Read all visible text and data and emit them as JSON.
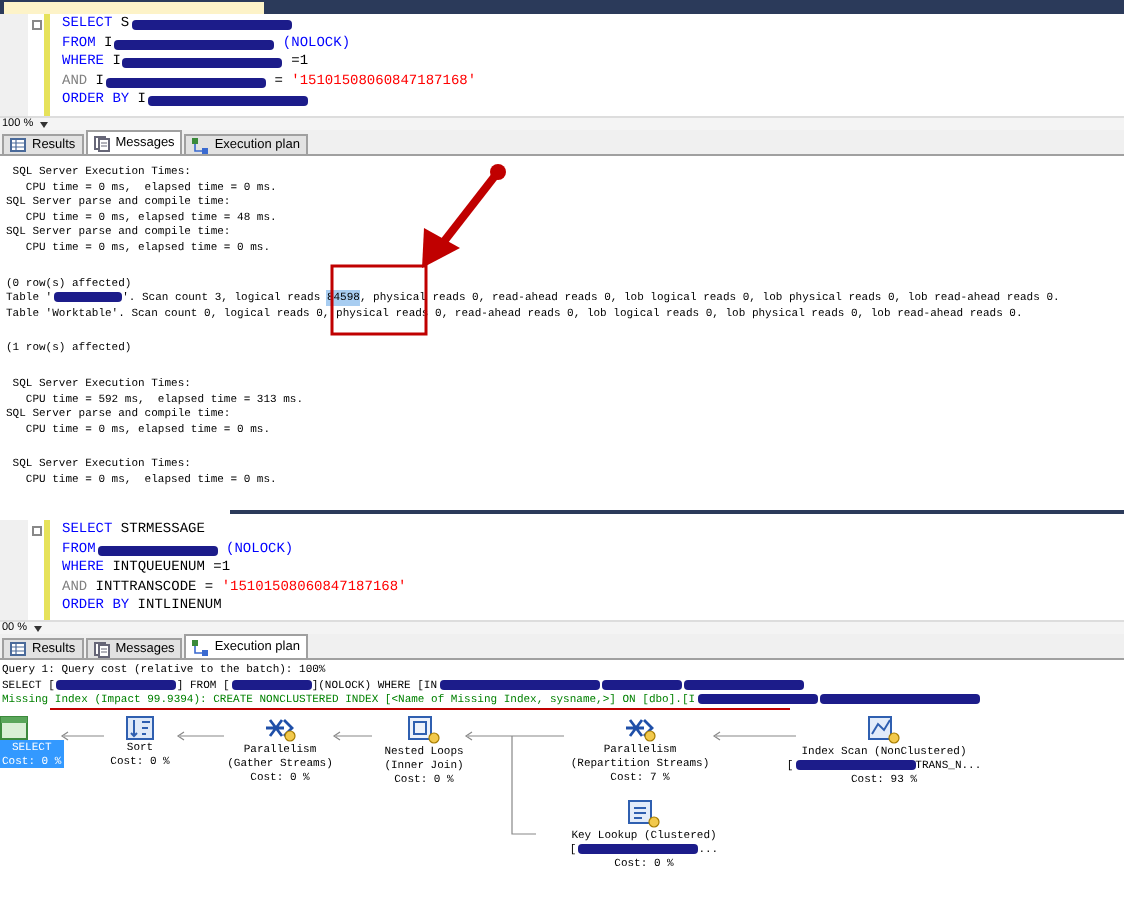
{
  "top_editor": {
    "lines": [
      [
        {
          "kind": "keyword",
          "text": "SELECT"
        },
        {
          "kind": "text",
          "text": " S"
        },
        {
          "kind": "redacted"
        }
      ],
      [
        {
          "kind": "keyword",
          "text": "FROM"
        },
        {
          "kind": "text",
          "text": " I"
        },
        {
          "kind": "redacted"
        },
        {
          "kind": "keyword",
          "text": " (NOLOCK)"
        }
      ],
      [
        {
          "kind": "keyword",
          "text": "WHERE"
        },
        {
          "kind": "text",
          "text": " I"
        },
        {
          "kind": "redacted"
        },
        {
          "kind": "text",
          "text": " =1"
        }
      ],
      [
        {
          "kind": "operator",
          "text": "AND"
        },
        {
          "kind": "text",
          "text": " I"
        },
        {
          "kind": "redacted"
        },
        {
          "kind": "text",
          "text": " = "
        },
        {
          "kind": "string",
          "text": "'15101508060847187168'"
        }
      ],
      [
        {
          "kind": "keyword",
          "text": "ORDER BY"
        },
        {
          "kind": "text",
          "text": " I"
        },
        {
          "kind": "redacted"
        }
      ]
    ],
    "zoom": "100 %"
  },
  "top_tabs": [
    {
      "label": "Results",
      "kind": "grid",
      "selected": false
    },
    {
      "label": "Messages",
      "kind": "messages",
      "selected": true
    },
    {
      "label": "Execution plan",
      "kind": "plan",
      "selected": false
    }
  ],
  "messages": [
    [
      [
        {
          "kind": "text",
          "text": " SQL Server Execution Times:"
        }
      ],
      [
        {
          "kind": "text",
          "text": "   CPU time = 0 ms,  elapsed time = 0 ms."
        }
      ],
      [
        {
          "kind": "text",
          "text": "SQL Server parse and compile time:"
        }
      ],
      [
        {
          "kind": "text",
          "text": "   CPU time = 0 ms, elapsed time = 48 ms."
        }
      ],
      [
        {
          "kind": "text",
          "text": "SQL Server parse and compile time:"
        }
      ],
      [
        {
          "kind": "text",
          "text": "   CPU time = 0 ms, elapsed time = 0 ms."
        }
      ]
    ],
    [
      [
        {
          "kind": "text",
          "text": "(0 row(s) affected)"
        }
      ],
      [
        {
          "kind": "text",
          "text": "Table '"
        },
        {
          "kind": "redacted"
        },
        {
          "kind": "text",
          "text": "'. Scan count 3, logical reads "
        },
        {
          "kind": "selected",
          "text": "84598"
        },
        {
          "kind": "text",
          "text": ", physical reads 0, read-ahead reads 0, lob logical reads 0, lob physical reads 0, lob read-ahead reads 0."
        }
      ],
      [
        {
          "kind": "text",
          "text": "Table 'Worktable'. Scan count 0, logical reads 0, physical reads 0, read-ahead reads 0, lob logical reads 0, lob physical reads 0, lob read-ahead reads 0."
        }
      ]
    ],
    [
      [
        {
          "kind": "text",
          "text": "(1 row(s) affected)"
        }
      ]
    ],
    [
      [
        {
          "kind": "text",
          "text": " SQL Server Execution Times:"
        }
      ],
      [
        {
          "kind": "text",
          "text": "   CPU time = 592 ms,  elapsed time = 313 ms."
        }
      ],
      [
        {
          "kind": "text",
          "text": "SQL Server parse and compile time:"
        }
      ],
      [
        {
          "kind": "text",
          "text": "   CPU time = 0 ms, elapsed time = 0 ms."
        }
      ]
    ],
    [
      [
        {
          "kind": "text",
          "text": " SQL Server Execution Times:"
        }
      ],
      [
        {
          "kind": "text",
          "text": "   CPU time = 0 ms,  elapsed time = 0 ms."
        }
      ]
    ]
  ],
  "bottom_editor": {
    "lines": [
      [
        {
          "kind": "keyword",
          "text": "SELECT"
        },
        {
          "kind": "text",
          "text": " STRMESSAGE"
        }
      ],
      [
        {
          "kind": "keyword",
          "text": "FROM"
        },
        {
          "kind": "redacted"
        },
        {
          "kind": "keyword",
          "text": " (NOLOCK)"
        }
      ],
      [
        {
          "kind": "keyword",
          "text": "WHERE"
        },
        {
          "kind": "text",
          "text": " INTQUEUENUM =1"
        }
      ],
      [
        {
          "kind": "operator",
          "text": "AND"
        },
        {
          "kind": "text",
          "text": " INTTRANSCODE = "
        },
        {
          "kind": "string",
          "text": "'15101508060847187168'"
        }
      ],
      [
        {
          "kind": "keyword",
          "text": "ORDER BY"
        },
        {
          "kind": "text",
          "text": " INTLINENUM"
        }
      ]
    ],
    "zoom": "00 %"
  },
  "bottom_tabs": [
    {
      "label": "Results",
      "kind": "grid",
      "selected": false
    },
    {
      "label": "Messages",
      "kind": "messages",
      "selected": false
    },
    {
      "label": "Execution plan",
      "kind": "plan",
      "selected": true
    }
  ],
  "plan": {
    "header": [
      [
        {
          "kind": "text",
          "text": "Query 1: Query cost (relative to the batch): 100%"
        }
      ],
      [
        {
          "kind": "text",
          "text": "SELECT ["
        },
        {
          "kind": "redacted"
        },
        {
          "kind": "text",
          "text": "] FROM ["
        },
        {
          "kind": "redacted"
        },
        {
          "kind": "text",
          "text": "](NOLOCK) WHERE [IN"
        },
        {
          "kind": "redacted"
        },
        {
          "kind": "redacted"
        },
        {
          "kind": "redacted"
        }
      ],
      [
        {
          "kind": "hint",
          "text": "Missing Index (Impact 99.9394): CREATE NONCLUSTERED INDEX [<Name of Missing Index, sysname,>] ON [dbo].[I"
        },
        {
          "kind": "redacted"
        },
        {
          "kind": "redacted"
        }
      ]
    ],
    "nodes": [
      {
        "kind": "select",
        "title": "SELECT",
        "cost": "Cost: 0 %",
        "selected": true
      },
      {
        "kind": "sort",
        "title": "Sort",
        "cost": "Cost: 0 %",
        "selected": false
      },
      {
        "kind": "parallelism",
        "title": "Parallelism",
        "subtitle": "(Gather Streams)",
        "cost": "Cost: 0 %",
        "selected": false
      },
      {
        "kind": "nested_loops",
        "title": "Nested Loops",
        "subtitle": "(Inner Join)",
        "cost": "Cost: 0 %",
        "selected": false
      },
      {
        "kind": "parallelism",
        "title": "Parallelism",
        "subtitle": "(Repartition Streams)",
        "cost": "Cost: 7 %",
        "selected": false
      },
      {
        "kind": "index_scan",
        "title": "Index Scan (NonClustered)",
        "object": [
          {
            "kind": "text",
            "text": "["
          },
          {
            "kind": "redacted"
          },
          {
            "kind": "text",
            "text": "TRANS_N..."
          }
        ],
        "cost": "Cost: 93 %",
        "selected": false
      },
      {
        "kind": "key_lookup",
        "title": "Key Lookup (Clustered)",
        "object": [
          {
            "kind": "text",
            "text": "["
          },
          {
            "kind": "redacted"
          },
          {
            "kind": "text",
            "text": "..."
          }
        ],
        "cost": "Cost: 0 %",
        "selected": false
      }
    ]
  }
}
